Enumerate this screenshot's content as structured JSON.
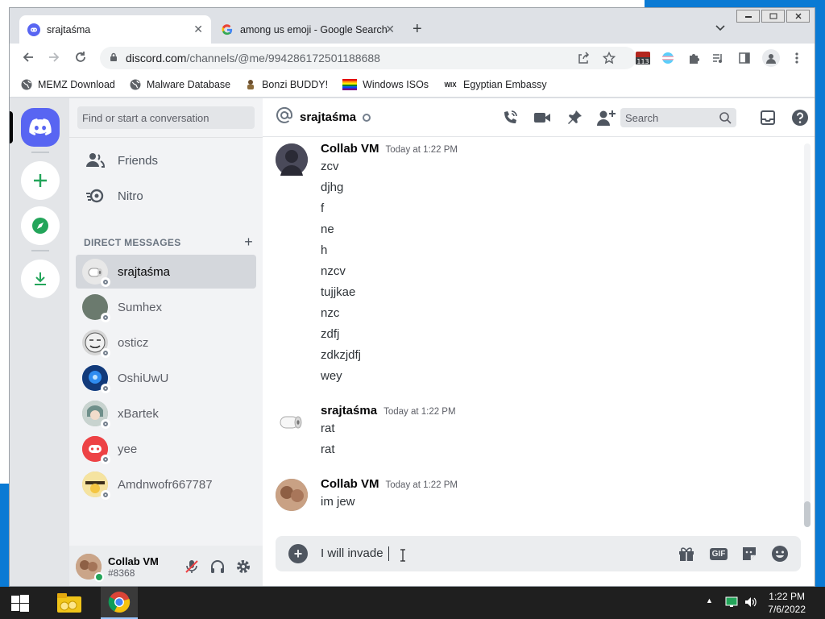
{
  "browser": {
    "tabs": [
      {
        "label": "srajtaśma",
        "close": "✕"
      },
      {
        "label": "among us emoji - Google Search",
        "close": "✕"
      }
    ],
    "new_tab": "+",
    "url_host": "discord.com",
    "url_path": "/channels/@me/994286172501188688",
    "extension_badge": "113",
    "bookmarks": [
      {
        "label": "MEMZ Download",
        "icon": "globe-icon"
      },
      {
        "label": "Malware Database",
        "icon": "globe-icon"
      },
      {
        "label": "Bonzi BUDDY!",
        "icon": "bonzi-icon"
      },
      {
        "label": "Windows ISOs",
        "icon": "windows-flag-icon"
      },
      {
        "label": "Egyptian Embassy",
        "icon": "wix-icon"
      }
    ],
    "wix_label": "WIX"
  },
  "discord": {
    "search_placeholder": "Find or start a conversation",
    "nav": {
      "friends": "Friends",
      "nitro": "Nitro"
    },
    "dm_header": "DIRECT MESSAGES",
    "dm_add": "+",
    "dms": [
      {
        "name": "srajtaśma",
        "avatar_color": "#e8e8e8",
        "selected": true
      },
      {
        "name": "Sumhex",
        "avatar_color": "#6b7a6e",
        "selected": false
      },
      {
        "name": "osticz",
        "avatar_color": "#8a8a8a",
        "selected": false
      },
      {
        "name": "OshiUwU",
        "avatar_color": "#1f5fbf",
        "selected": false
      },
      {
        "name": "xBartek",
        "avatar_color": "#9fb0a8",
        "selected": false
      },
      {
        "name": "yee",
        "avatar_color": "#ed4245",
        "selected": false
      },
      {
        "name": "Amdnwofr667787",
        "avatar_color": "#d9c27a",
        "selected": false
      }
    ],
    "user": {
      "name": "Collab VM",
      "tag": "#8368"
    },
    "channel": {
      "name": "srajtaśma",
      "search_placeholder": "Search"
    },
    "messages": [
      {
        "author": "Collab VM",
        "time": "Today at 1:22 PM",
        "avatar_color": "#3b3b4a",
        "lines": [
          "zcv",
          "djhg",
          "f",
          "ne",
          "h",
          "nzcv",
          "tujjkae",
          "nzc",
          "zdfj",
          "zdkzjdfj",
          "wey"
        ]
      },
      {
        "author": "srajtaśma",
        "time": "Today at 1:22 PM",
        "avatar_color": "#e6e6e6",
        "lines": [
          "rat",
          "rat"
        ]
      },
      {
        "author": "Collab VM",
        "time": "Today at 1:22 PM",
        "avatar_color": "#8a6a55",
        "lines": [
          "im jew"
        ]
      }
    ],
    "composer_text": "I will invade ",
    "composer_add": "+",
    "gif_label": "GIF"
  },
  "taskbar": {
    "time": "1:22 PM",
    "date": "7/6/2022"
  },
  "colors": {
    "blurple": "#5865f2",
    "green": "#23a55a",
    "red": "#ed4245"
  }
}
